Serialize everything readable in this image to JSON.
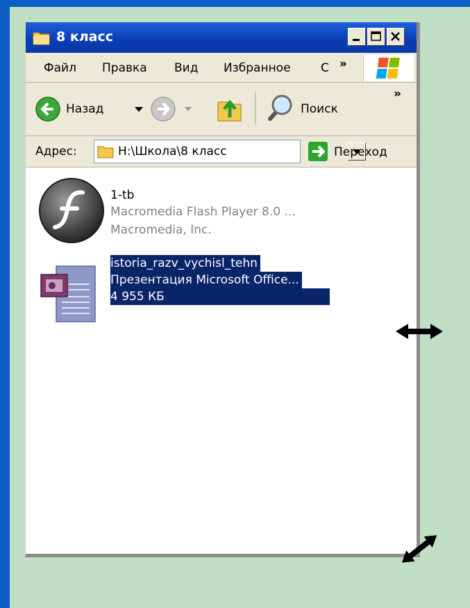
{
  "window": {
    "title": "8 класс",
    "menu": [
      "Файл",
      "Правка",
      "Вид",
      "Избранное",
      "С"
    ],
    "toolbar": {
      "back_label": "Назад",
      "search_label": "Поиск",
      "overflow": "»"
    },
    "address": {
      "label": "Адрес:",
      "value": "H:\\Школа\\8 класс",
      "go_label": "Переход"
    }
  },
  "files": [
    {
      "name": "1-tb",
      "type": "Macromedia Flash Player 8.0  ...",
      "detail": "Macromedia, Inc.",
      "icon": "flash-icon",
      "selected": false
    },
    {
      "name": "istoria_razv_vychisl_tehn",
      "type": "Презентация Microsoft Office...",
      "detail": "4 955 КБ",
      "icon": "powerpoint-icon",
      "selected": true
    }
  ],
  "colors": {
    "slide_bg": "#c1dfc5",
    "frame": "#0a5fc4",
    "titlebar": "#0a3cb4",
    "selection": "#0a246a"
  }
}
